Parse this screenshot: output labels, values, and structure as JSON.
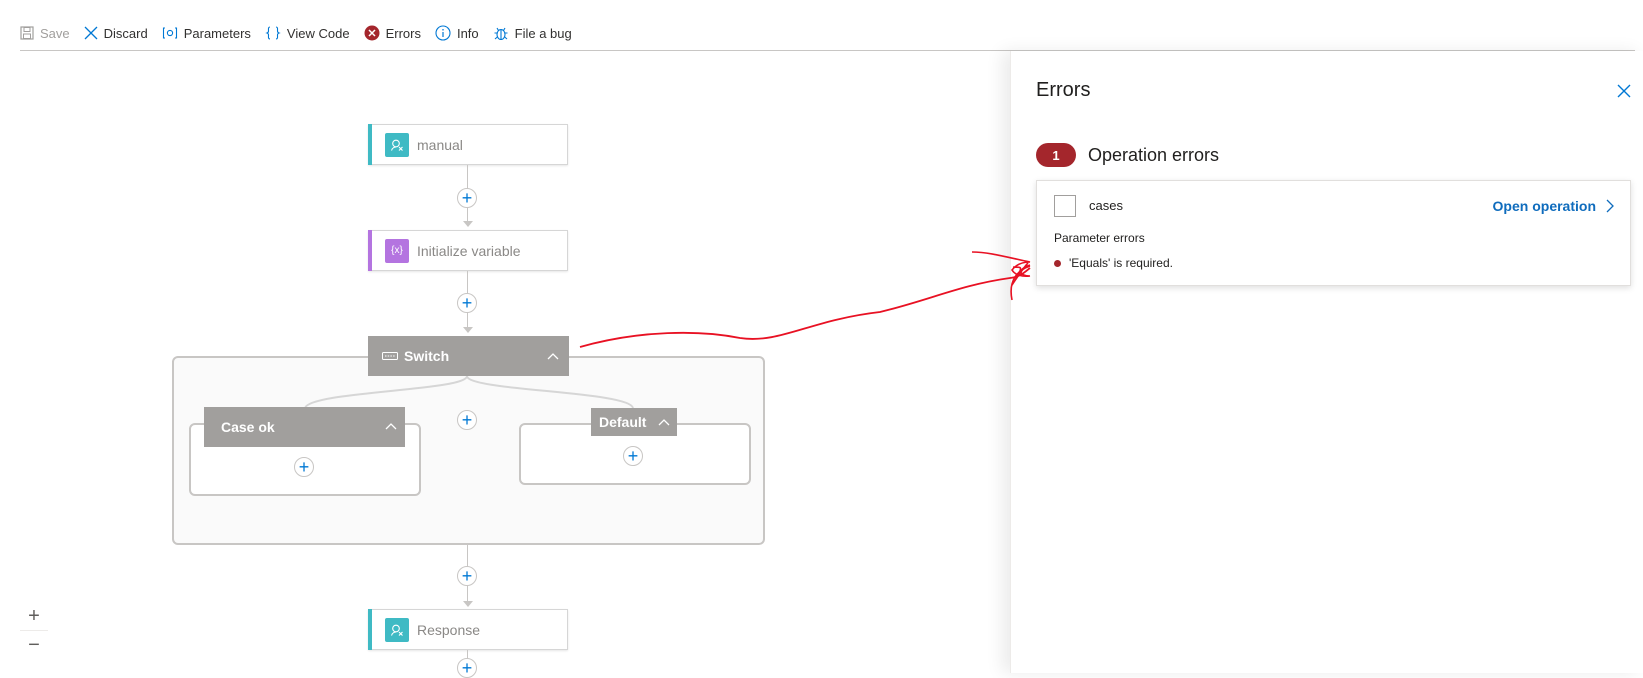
{
  "toolbar": {
    "save": "Save",
    "discard": "Discard",
    "parameters": "Parameters",
    "view_code": "View Code",
    "errors": "Errors",
    "info": "Info",
    "file_bug": "File a bug"
  },
  "canvas": {
    "nodes": {
      "manual": "manual",
      "init_var": "Initialize variable",
      "switch": "Switch",
      "case_ok": "Case ok",
      "default": "Default",
      "response": "Response"
    },
    "zoom_in": "+",
    "zoom_out": "−",
    "add": "+"
  },
  "colors": {
    "trigger_accent": "#3fbac4",
    "variable_accent": "#b474e0",
    "error_red": "#a4262c",
    "link_blue": "#0f6cbd"
  },
  "panel": {
    "title": "Errors",
    "badge_count": "1",
    "section_title": "Operation errors",
    "card": {
      "title": "cases",
      "open_label": "Open operation",
      "param_title": "Parameter errors",
      "error_text": "'Equals' is required."
    }
  }
}
